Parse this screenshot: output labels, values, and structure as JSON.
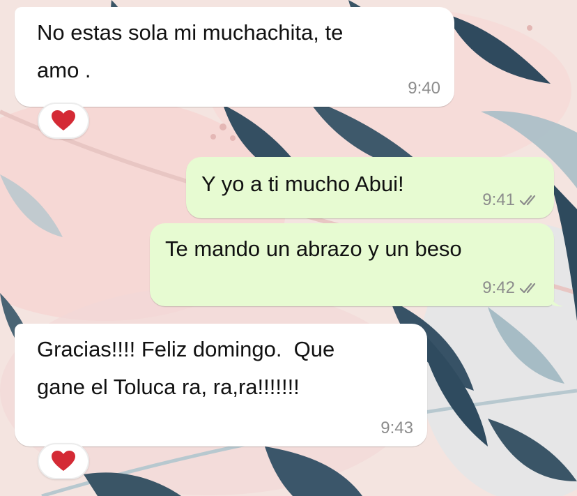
{
  "chat": {
    "messages": [
      {
        "direction": "incoming",
        "text": "No estas sola mi muchachita, te\namo .",
        "time": "9:40",
        "reaction": "heart"
      },
      {
        "direction": "outgoing",
        "text": "Y yo a ti mucho Abui!",
        "time": "9:41",
        "status": "read-double-check"
      },
      {
        "direction": "outgoing",
        "text": "Te mando un abrazo y un beso",
        "time": "9:42",
        "status": "read-double-check"
      },
      {
        "direction": "incoming",
        "text": "Gracias!!!! Feliz domingo.  Que\ngane el Toluca ra, ra,ra!!!!!!!",
        "time": "9:43",
        "reaction": "heart"
      }
    ]
  },
  "theme": {
    "incoming_bubble": "#ffffff",
    "outgoing_bubble": "#e7fbd2",
    "text_color": "#111111",
    "time_color": "#8c8c8c",
    "reaction_color": "#d42a35"
  },
  "icons": {
    "reaction": "red-heart-icon",
    "delivery_status": "double-check-icon"
  }
}
